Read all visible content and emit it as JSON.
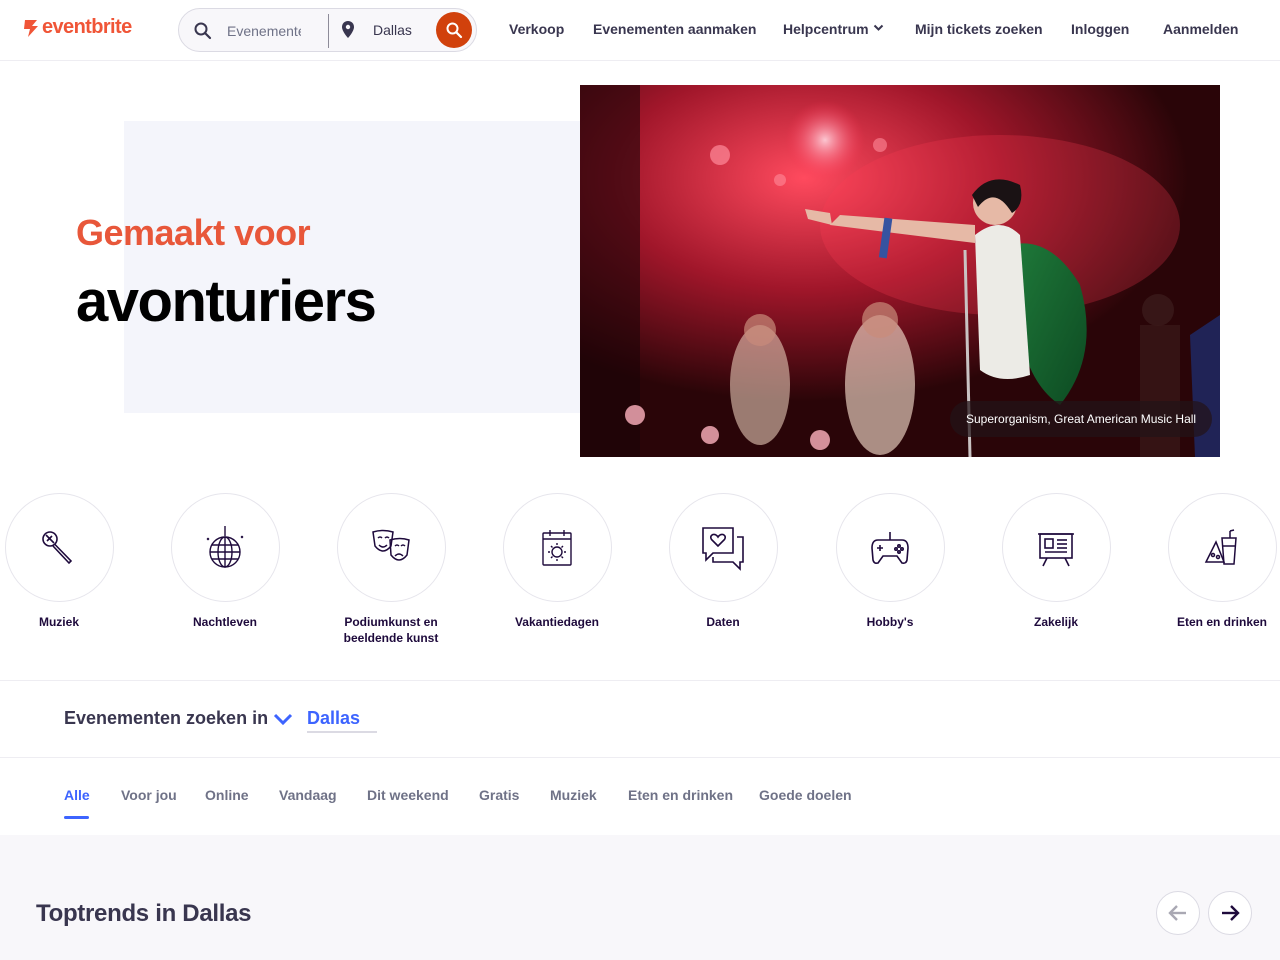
{
  "header": {
    "logo_text": "eventbrite",
    "search_placeholder": "Evenementen zoeken",
    "location": "Dallas",
    "nav": {
      "sell": "Verkoop",
      "create": "Evenementen aanmaken",
      "help": "Helpcentrum",
      "find_tickets": "Mijn tickets zoeken",
      "login": "Inloggen",
      "signup": "Aanmelden"
    }
  },
  "hero": {
    "line1": "Gemaakt voor",
    "line2": "avonturiers",
    "caption": "Superorganism, Great American Music Hall"
  },
  "categories": [
    {
      "label": "Muziek",
      "icon": "microphone-icon"
    },
    {
      "label": "Nachtleven",
      "icon": "disco-ball-icon"
    },
    {
      "label": "Podiumkunst en beeldende kunst",
      "icon": "theater-masks-icon"
    },
    {
      "label": "Vakantiedagen",
      "icon": "calendar-sun-icon"
    },
    {
      "label": "Daten",
      "icon": "chat-heart-icon"
    },
    {
      "label": "Hobby's",
      "icon": "gamepad-icon"
    },
    {
      "label": "Zakelijk",
      "icon": "presentation-board-icon"
    },
    {
      "label": "Eten en drinken",
      "icon": "food-drink-icon"
    }
  ],
  "location_picker": {
    "label": "Evenementen zoeken in",
    "value": "Dallas"
  },
  "tabs": [
    "Alle",
    "Voor jou",
    "Online",
    "Vandaag",
    "Dit weekend",
    "Gratis",
    "Muziek",
    "Eten en drinken",
    "Goede doelen"
  ],
  "active_tab": "Alle",
  "trending": {
    "title": "Toptrends in Dallas"
  },
  "colors": {
    "brand": "#f05537",
    "search_button": "#d1410c",
    "accent_blue": "#3d64ff",
    "hero_orange": "#e8573a"
  }
}
